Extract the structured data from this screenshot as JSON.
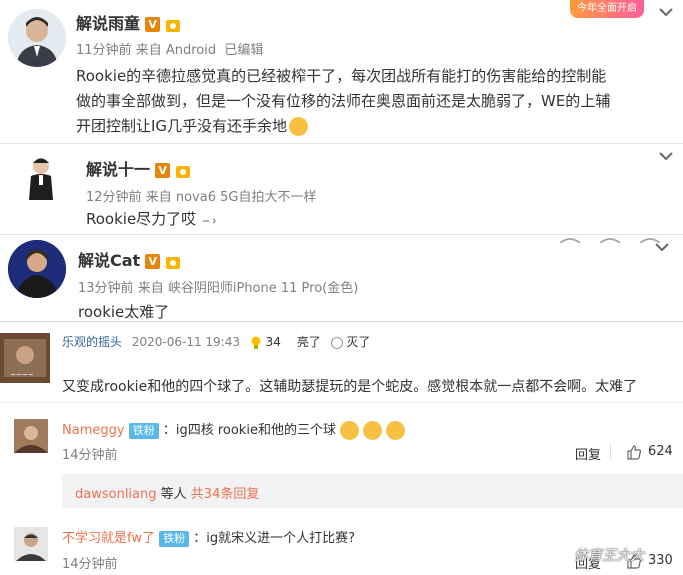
{
  "comments": [
    {
      "author": "解说雨童",
      "time": "11分钟前",
      "source_prefix": "来自",
      "source": "Android",
      "edited": "已编辑",
      "text_lines": [
        "Rookie的辛德拉感觉真的已经被榨干了，每次团战所有能打的伤害能给的控制能",
        "做的事全部做到，但是一个没有位移的法师在奥恩面前还是太脆弱了，WE的上辅",
        "开团控制让IG几乎没有还手余地"
      ],
      "banner_text": "今年全面开启"
    },
    {
      "author": "解说十一",
      "time": "12分钟前",
      "source_prefix": "来自",
      "source": "nova6 5G自拍大不一样",
      "text": "Rookie尽力了哎"
    },
    {
      "author": "解说Cat",
      "time": "13分钟前",
      "source_prefix": "来自",
      "source": "峡谷阴阳师iPhone 11 Pro(金色)",
      "text": "rookie太难了"
    }
  ],
  "main_post": {
    "author": "乐观的摇头",
    "datetime": "2020-06-11 19:43",
    "likes": "34",
    "action_light": "亮了",
    "action_off": "灭了",
    "text": "又变成rookie和他的四个球了。这辅助瑟提玩的是个蛇皮。感觉根本就一点都不会啊。太难了"
  },
  "replies": [
    {
      "author": "Nameggy",
      "badge": "铁粉",
      "text": "：ig四核 rookie和他的三个球",
      "time": "14分钟前",
      "reply_label": "回复",
      "likes": "624"
    },
    {
      "author": "dawsonliang",
      "text": "等人",
      "more": "共34条回复"
    },
    {
      "author": "不学习就是fw了",
      "badge": "铁粉",
      "text": "：ig就宋义进一个人打比赛?",
      "time": "14分钟前",
      "reply_label": "回复",
      "likes": "330"
    }
  ],
  "watermark": "体育王大大",
  "colors": {
    "vip_orange": "#e5850b",
    "link_orange": "#eb7350",
    "fan_blue": "#59b7ea",
    "meta_gray": "#808080"
  }
}
